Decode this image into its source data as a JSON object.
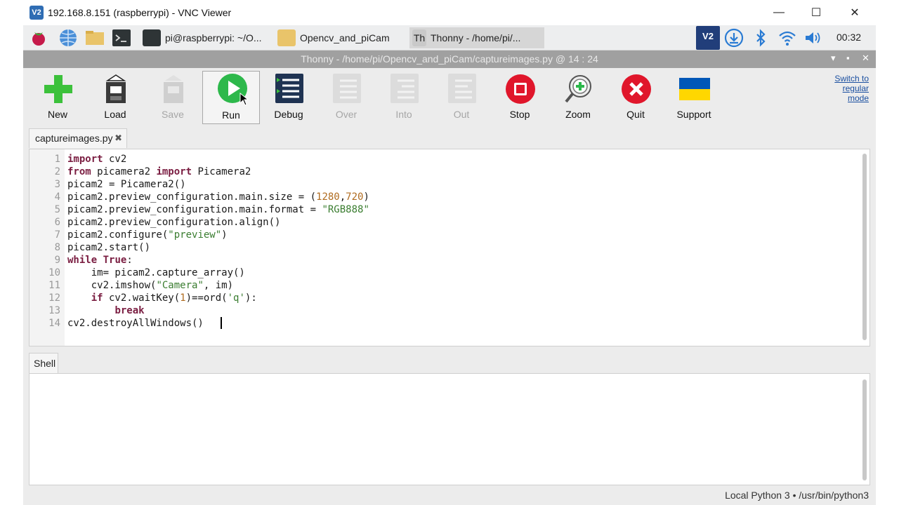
{
  "vnc": {
    "title": "192.168.8.151 (raspberrypi) - VNC Viewer",
    "icon_label": "V2",
    "minimize": "—",
    "maximize": "☐",
    "close": "✕"
  },
  "taskbar": {
    "tasks": [
      {
        "label": "pi@raspberrypi: ~/O..."
      },
      {
        "label": "Opencv_and_piCam"
      },
      {
        "label": "Thonny  -  /home/pi/..."
      }
    ],
    "clock": "00:32",
    "vnc_tray_label": "V2"
  },
  "thonny": {
    "title": "Thonny  -  /home/pi/Opencv_and_piCam/captureimages.py  @  14 : 24",
    "ctrl_min": "▾",
    "ctrl_max": "▪",
    "ctrl_close": "✕",
    "toolbar": [
      {
        "label": "New",
        "enabled": true
      },
      {
        "label": "Load",
        "enabled": true
      },
      {
        "label": "Save",
        "enabled": false
      },
      {
        "label": "Run",
        "enabled": true
      },
      {
        "label": "Debug",
        "enabled": true
      },
      {
        "label": "Over",
        "enabled": false
      },
      {
        "label": "Into",
        "enabled": false
      },
      {
        "label": "Out",
        "enabled": false
      },
      {
        "label": "Stop",
        "enabled": true
      },
      {
        "label": "Zoom",
        "enabled": true
      },
      {
        "label": "Quit",
        "enabled": true
      },
      {
        "label": "Support",
        "enabled": true
      }
    ],
    "switch_mode": [
      "Switch to",
      "regular",
      "mode"
    ],
    "editor_tab": "captureimages.py",
    "editor_tab_close": "✖",
    "line_numbers": [
      "1",
      "2",
      "3",
      "4",
      "5",
      "6",
      "7",
      "8",
      "9",
      "10",
      "11",
      "12",
      "13",
      "14"
    ],
    "code": [
      [
        {
          "t": "import",
          "c": "kw"
        },
        {
          "t": " cv2",
          "c": ""
        }
      ],
      [
        {
          "t": "from",
          "c": "kw"
        },
        {
          "t": " picamera2 ",
          "c": ""
        },
        {
          "t": "import",
          "c": "kw"
        },
        {
          "t": " Picamera2",
          "c": ""
        }
      ],
      [
        {
          "t": "picam2 = Picamera2()",
          "c": ""
        }
      ],
      [
        {
          "t": "picam2.preview_configuration.main.size = (",
          "c": ""
        },
        {
          "t": "1280",
          "c": "num"
        },
        {
          "t": ",",
          "c": ""
        },
        {
          "t": "720",
          "c": "num"
        },
        {
          "t": ")",
          "c": ""
        }
      ],
      [
        {
          "t": "picam2.preview_configuration.main.format = ",
          "c": ""
        },
        {
          "t": "\"RGB888\"",
          "c": "str"
        }
      ],
      [
        {
          "t": "picam2.preview_configuration.align()",
          "c": ""
        }
      ],
      [
        {
          "t": "picam2.configure(",
          "c": ""
        },
        {
          "t": "\"preview\"",
          "c": "str"
        },
        {
          "t": ")",
          "c": ""
        }
      ],
      [
        {
          "t": "picam2.start()",
          "c": ""
        }
      ],
      [
        {
          "t": "while",
          "c": "kw"
        },
        {
          "t": " ",
          "c": ""
        },
        {
          "t": "True",
          "c": "kw"
        },
        {
          "t": ":",
          "c": ""
        }
      ],
      [
        {
          "t": "    im= picam2.capture_array()",
          "c": ""
        }
      ],
      [
        {
          "t": "    cv2.imshow(",
          "c": ""
        },
        {
          "t": "\"Camera\"",
          "c": "str"
        },
        {
          "t": ", im)",
          "c": ""
        }
      ],
      [
        {
          "t": "    ",
          "c": ""
        },
        {
          "t": "if",
          "c": "kw"
        },
        {
          "t": " cv2.waitKey(",
          "c": ""
        },
        {
          "t": "1",
          "c": "num"
        },
        {
          "t": ")==ord(",
          "c": ""
        },
        {
          "t": "'q'",
          "c": "str"
        },
        {
          "t": "):",
          "c": ""
        }
      ],
      [
        {
          "t": "        ",
          "c": ""
        },
        {
          "t": "break",
          "c": "kw"
        }
      ],
      [
        {
          "t": "cv2.destroyAllWindows()",
          "c": ""
        }
      ]
    ],
    "shell_tab": "Shell",
    "status": "Local Python 3  •  /usr/bin/python3"
  },
  "colors": {
    "run_green": "#2db84b",
    "stop_red": "#e0162b",
    "quit_red": "#e0162b",
    "new_green": "#3cc13b",
    "ukraine_blue": "#0057b7",
    "ukraine_yellow": "#ffd700"
  }
}
